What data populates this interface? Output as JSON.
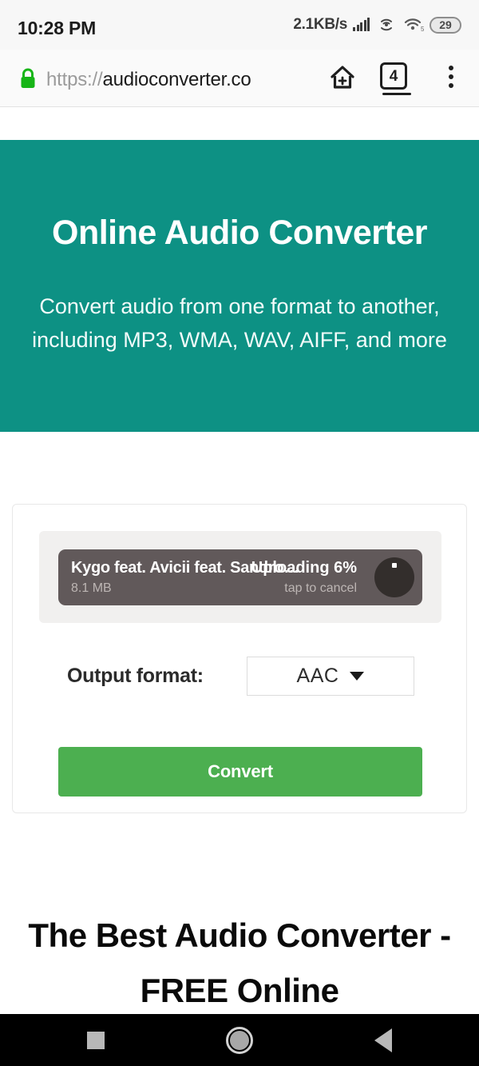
{
  "statusbar": {
    "time": "10:28 PM",
    "network_speed": "2.1KB/s",
    "signal_icon": "signal-bars-icon",
    "hotspot_icon": "hotspot-icon",
    "wifi_icon": "wifi-5-icon",
    "battery_level": "29"
  },
  "browser": {
    "lock_icon": "lock-icon",
    "url_scheme": "https://",
    "url_host": "audioconverter.co",
    "add_home_icon": "home-plus-icon",
    "tab_count": "4",
    "menu_icon": "three-dots-menu-icon"
  },
  "hero": {
    "title": "Online Audio Converter",
    "subtitle": "Convert audio from one format to another, including MP3, WMA, WAV, AIFF, and more",
    "background_color": "#0d9184"
  },
  "converter": {
    "upload": {
      "file_name": "Kygo feat. Avicii feat. Sandro…",
      "file_size": "8.1 MB",
      "status": "Uploading 6%",
      "cancel_hint": "tap to cancel",
      "progress_percent": 6,
      "spinner_icon": "circular-progress-icon"
    },
    "format_label": "Output format:",
    "format_value": "AAC",
    "format_caret_icon": "chevron-down-icon",
    "convert_label": "Convert",
    "convert_color": "#4caf50"
  },
  "lower_section": {
    "headline": "The Best Audio Converter - FREE Online"
  },
  "navbar": {
    "recents_icon": "recents-square-icon",
    "home_icon": "home-circle-icon",
    "back_icon": "back-triangle-icon"
  }
}
